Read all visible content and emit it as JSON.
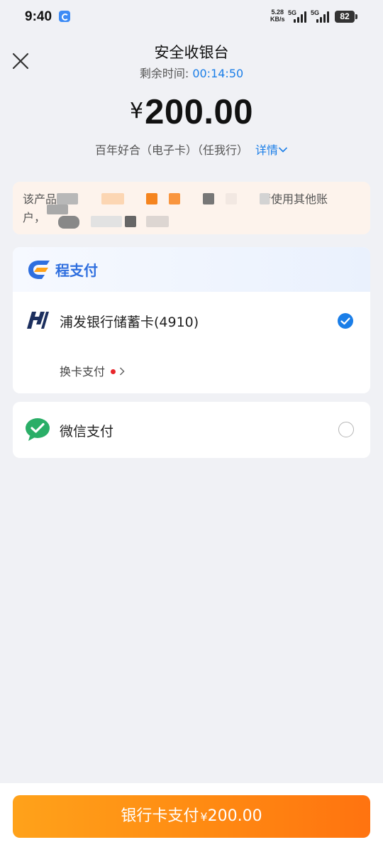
{
  "status_bar": {
    "time": "9:40",
    "speed_value": "5.28",
    "speed_unit": "KB/s",
    "net1": "5G",
    "net2": "5G",
    "battery": "82"
  },
  "header": {
    "title": "安全收银台",
    "timer_label": "剩余时间: ",
    "timer_value": "00:14:50"
  },
  "order": {
    "currency": "¥",
    "amount": "200.00",
    "product": "百年好合（电子卡）（任我行）",
    "detail_label": "详情"
  },
  "notice": {
    "line1_start": "该产品仅",
    "line1_end": "请使用其他账",
    "line2_start": "户，"
  },
  "payment": {
    "provider_name": "程支付",
    "bank_card": "浦发银行储蓄卡(4910)",
    "switch_card_label": "换卡支付",
    "wechat_label": "微信支付",
    "selected": "bank_card"
  },
  "pay_button": {
    "label": "银行卡支付",
    "currency": "¥",
    "amount": "200.00"
  },
  "colors": {
    "accent_blue": "#1a7ee8",
    "pay_orange": "#ff8a12",
    "wechat_green": "#2aae67",
    "spdb_navy": "#1c2f5e",
    "notice_bg": "#fdf3ec"
  }
}
